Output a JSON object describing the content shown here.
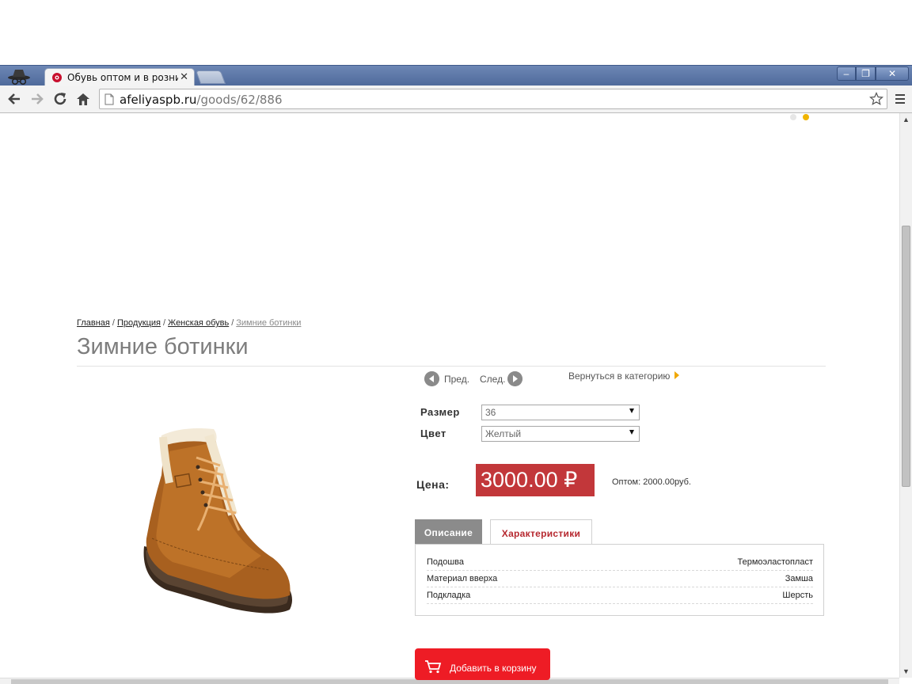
{
  "browser": {
    "tab_title": "Обувь оптом и в розниц",
    "tab_close": "✕",
    "url_domain": "afeliyaspb.ru",
    "url_path": "/goods/62/886",
    "window_min": "–",
    "window_max": "❐",
    "window_close": "✕"
  },
  "breadcrumb": {
    "home": "Главная",
    "products": "Продукция",
    "womens": "Женская обувь",
    "current": "Зимние ботинки",
    "separator": "/"
  },
  "product": {
    "title": "Зимние ботинки",
    "prev_label": "Пред.",
    "next_label": "След.",
    "back_to_category": "Вернуться в категорию",
    "size_label": "Размер",
    "size_value": "36",
    "color_label": "Цвет",
    "color_value": "Желтый",
    "price_label": "Цена:",
    "price_value": "3000.00 ₽",
    "wholesale": "Оптом: 2000.00руб.",
    "tab_description": "Описание",
    "tab_specs": "Характеристики",
    "specs": [
      {
        "key": "Подошва",
        "value": "Термоэластопласт"
      },
      {
        "key": "Материал вверха",
        "value": "Замша"
      },
      {
        "key": "Подкладка",
        "value": "Шерсть"
      }
    ],
    "add_to_cart": "Добавить в корзину"
  },
  "colors": {
    "price_bg": "#c2373a",
    "cart_button": "#ee1c25",
    "tab_active_text": "#b6282f",
    "slider_dot_inactive": "#e6e6e6",
    "slider_dot_active": "#f0b400"
  }
}
